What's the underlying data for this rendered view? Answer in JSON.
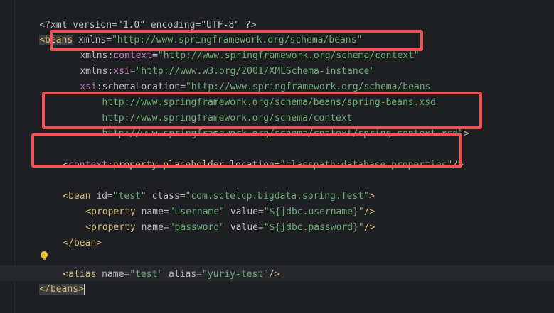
{
  "lines": {
    "l1": {
      "a": "<?xml version=\"1.0\" encoding=\"UTF-8\" ?>"
    },
    "l2": {
      "open": "<beans",
      "attr": " xmlns=",
      "val": "\"http://www.springframework.org/schema/beans\""
    },
    "l3": {
      "prefix": "xmlns",
      "colon": ":",
      "ns": "context",
      "eq": "=",
      "val": "\"http://www.springframework.org/schema/context\""
    },
    "l4": {
      "prefix": "xmlns",
      "colon": ":",
      "ns": "xsi",
      "eq": "=",
      "val": "\"http://www.w3.org/2001/XMLSchema-instance\""
    },
    "l5": {
      "ns": "xsi",
      "colon": ":",
      "attr": "schemaLocation=",
      "val": "\"http://www.springframework.org/schema/beans"
    },
    "l6": {
      "val": "http://www.springframework.org/schema/beans/spring-beans.xsd"
    },
    "l7": {
      "val": "http://www.springframework.org/schema/context"
    },
    "l8": {
      "val": "http://www.springframework.org/schema/context/spring-context.xsd\"",
      "close": ">"
    },
    "l9": {
      "open": "<",
      "ns": "context",
      "colon": ":",
      "tag": "property-placeholder",
      "attr": " location=",
      "val": "\"classpath:database.properties\"",
      "close": "/>"
    },
    "l10": {
      "open": "<bean",
      "attr1": " id=",
      "val1": "\"test\"",
      "attr2": " class=",
      "val2": "\"com.sctelcp.bigdata.spring.Test\"",
      "close": ">"
    },
    "l11": {
      "open": "<property",
      "attr1": " name=",
      "val1": "\"username\"",
      "attr2": " value=",
      "val2": "\"${jdbc.username}\"",
      "close": "/>"
    },
    "l12": {
      "open": "<property",
      "attr1": " name=",
      "val1": "\"password\"",
      "attr2": " value=",
      "val2": "\"${jdbc.password}\"",
      "close": "/>"
    },
    "l13": {
      "open": "</bean>"
    },
    "l14": {
      "open": "<alias",
      "attr1": " name=",
      "val1": "\"test\"",
      "attr2": " alias=",
      "val2": "\"yuriy-test\"",
      "close": "/>"
    },
    "l15": {
      "open": "</beans>"
    }
  },
  "colors": {
    "background": "#1e1f22",
    "tag": "#d5b778",
    "namespace": "#c77dbb",
    "value": "#6aab73",
    "text": "#bcbec4",
    "highlight_box": "#f05255"
  },
  "icons": {
    "intention_bulb": "lightbulb-icon"
  }
}
